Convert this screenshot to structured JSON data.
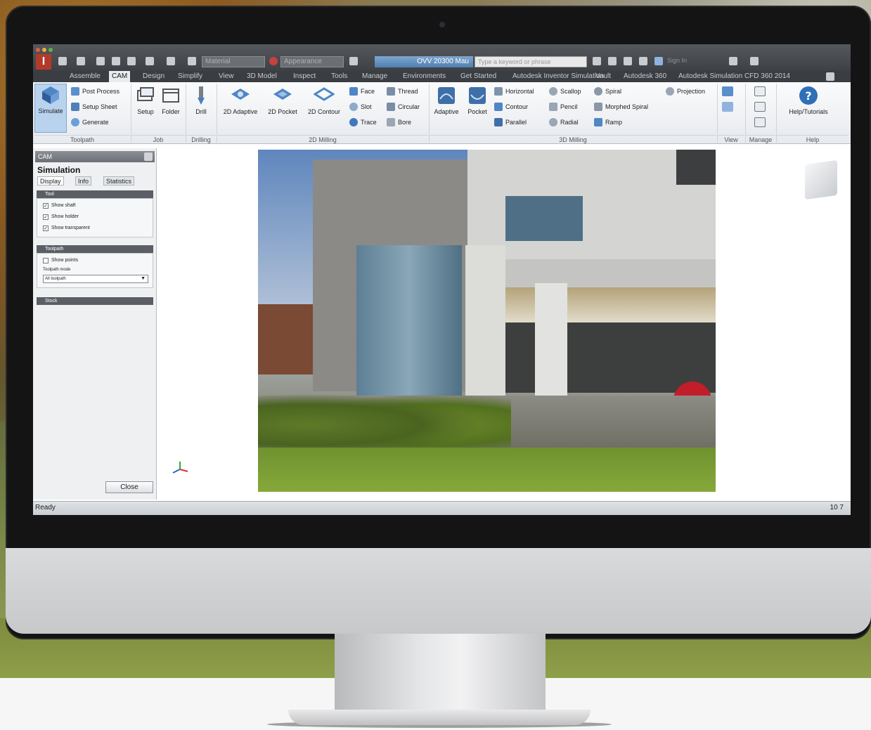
{
  "app": {
    "material_combo": "Material",
    "appearance_combo": "Appearance",
    "document_title": "OVV 20300 Mau",
    "help_search_placeholder": "Type a keyword or phrase",
    "user": "Sign In"
  },
  "tabs": [
    "Assemble",
    "CAM",
    "Design",
    "Simplify",
    "View",
    "3D Model",
    "Inspect",
    "Tools",
    "Manage",
    "Environments",
    "Get Started",
    "Autodesk Inventor Simulation",
    "Vault",
    "Autodesk 360",
    "Autodesk Simulation CFD 360 2014"
  ],
  "active_tab": "CAM",
  "ribbon": {
    "toolpath": {
      "label": "Toolpath",
      "simulate": "Simulate",
      "post_process": "Post Process",
      "setup_sheet": "Setup Sheet",
      "generate": "Generate"
    },
    "job": {
      "label": "Job",
      "setup": "Setup",
      "folder": "Folder"
    },
    "drilling": {
      "label": "Drilling",
      "drill": "Drill"
    },
    "milling2d": {
      "label": "2D Milling",
      "adaptive": "2D Adaptive",
      "pocket": "2D Pocket",
      "contour": "2D Contour",
      "face": "Face",
      "slot": "Slot",
      "trace": "Trace",
      "thread": "Thread",
      "circular": "Circular",
      "bore": "Bore"
    },
    "milling3d": {
      "label": "3D Milling",
      "adaptive": "Adaptive",
      "pocket": "Pocket",
      "horizontal": "Horizontal",
      "contour": "Contour",
      "parallel": "Parallel",
      "scallop": "Scallop",
      "pencil": "Pencil",
      "radial": "Radial",
      "spiral": "Spiral",
      "morphed_spiral": "Morphed Spiral",
      "ramp": "Ramp",
      "projection": "Projection"
    },
    "view": {
      "label": "View"
    },
    "manage": {
      "label": "Manage"
    },
    "help": {
      "label": "Help",
      "help_tutorials": "Help/Tutorials"
    }
  },
  "panel": {
    "header": "CAM",
    "title": "Simulation",
    "tabs": [
      "Display",
      "Info",
      "Statistics"
    ],
    "tool_section": "Tool",
    "tool_options": [
      "Show shaft",
      "Show holder",
      "Show transparent"
    ],
    "toolpath_section": "Toolpath",
    "toolpath_options": [
      "Show points"
    ],
    "toolpath_mode_label": "Toolpath mode",
    "toolpath_mode_value": "All toolpath",
    "stock_section": "Stock",
    "close": "Close"
  },
  "status": {
    "text": "Ready",
    "right": "10 7"
  }
}
